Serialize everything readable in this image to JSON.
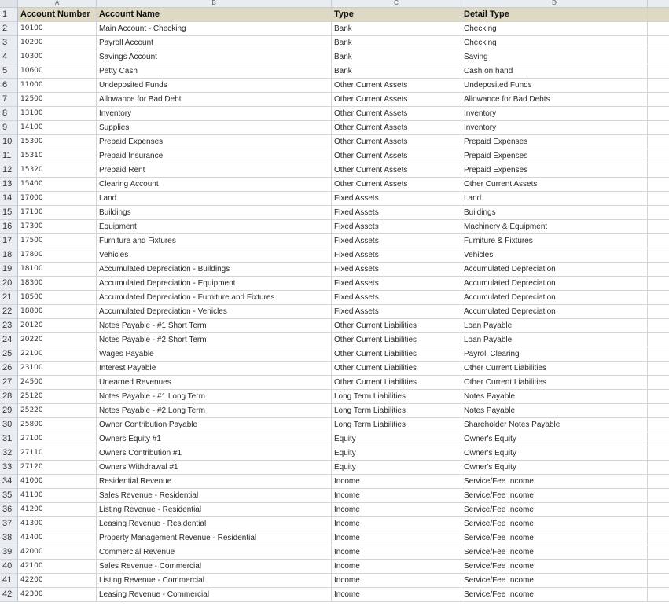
{
  "columns": [
    "A",
    "B",
    "C",
    "D"
  ],
  "header": {
    "row_number": "1",
    "account_number": "Account Number",
    "account_name": "Account Name",
    "type": "Type",
    "detail_type": "Detail Type"
  },
  "rows": [
    {
      "n": "2",
      "num": "10100",
      "name": "Main Account - Checking",
      "type": "Bank",
      "detail": "Checking"
    },
    {
      "n": "3",
      "num": "10200",
      "name": "Payroll Account",
      "type": "Bank",
      "detail": "Checking"
    },
    {
      "n": "4",
      "num": "10300",
      "name": "Savings Account",
      "type": "Bank",
      "detail": "Saving"
    },
    {
      "n": "5",
      "num": "10600",
      "name": "Petty Cash",
      "type": "Bank",
      "detail": "Cash on hand"
    },
    {
      "n": "6",
      "num": "11000",
      "name": "Undeposited Funds",
      "type": "Other Current Assets",
      "detail": "Undeposited Funds"
    },
    {
      "n": "7",
      "num": "12500",
      "name": "Allowance for Bad Debt",
      "type": "Other Current Assets",
      "detail": "Allowance for Bad Debts"
    },
    {
      "n": "8",
      "num": "13100",
      "name": "Inventory",
      "type": "Other Current Assets",
      "detail": "Inventory"
    },
    {
      "n": "9",
      "num": "14100",
      "name": "Supplies",
      "type": "Other Current Assets",
      "detail": "Inventory"
    },
    {
      "n": "10",
      "num": "15300",
      "name": "Prepaid Expenses",
      "type": "Other Current Assets",
      "detail": "Prepaid Expenses"
    },
    {
      "n": "11",
      "num": "15310",
      "name": "Prepaid Insurance",
      "type": "Other Current Assets",
      "detail": "Prepaid Expenses"
    },
    {
      "n": "12",
      "num": "15320",
      "name": "Prepaid Rent",
      "type": "Other Current Assets",
      "detail": "Prepaid Expenses"
    },
    {
      "n": "13",
      "num": "15400",
      "name": "Clearing Account",
      "type": "Other Current Assets",
      "detail": "Other Current Assets"
    },
    {
      "n": "14",
      "num": "17000",
      "name": "Land",
      "type": "Fixed Assets",
      "detail": "Land"
    },
    {
      "n": "15",
      "num": "17100",
      "name": "Buildings",
      "type": "Fixed Assets",
      "detail": "Buildings"
    },
    {
      "n": "16",
      "num": "17300",
      "name": "Equipment",
      "type": "Fixed Assets",
      "detail": "Machinery & Equipment"
    },
    {
      "n": "17",
      "num": "17500",
      "name": "Furniture and Fixtures",
      "type": "Fixed Assets",
      "detail": "Furniture & Fixtures"
    },
    {
      "n": "18",
      "num": "17800",
      "name": "Vehicles",
      "type": "Fixed Assets",
      "detail": "Vehicles"
    },
    {
      "n": "19",
      "num": "18100",
      "name": "Accumulated Depreciation - Buildings",
      "type": "Fixed Assets",
      "detail": "Accumulated Depreciation"
    },
    {
      "n": "20",
      "num": "18300",
      "name": "Accumulated Depreciation - Equipment",
      "type": "Fixed Assets",
      "detail": "Accumulated Depreciation"
    },
    {
      "n": "21",
      "num": "18500",
      "name": "Accumulated Depreciation - Furniture and Fixtures",
      "type": "Fixed Assets",
      "detail": "Accumulated Depreciation"
    },
    {
      "n": "22",
      "num": "18800",
      "name": "Accumulated Depreciation - Vehicles",
      "type": "Fixed Assets",
      "detail": "Accumulated Depreciation"
    },
    {
      "n": "23",
      "num": "20120",
      "name": "Notes Payable - #1 Short Term",
      "type": "Other Current Liabilities",
      "detail": "Loan Payable"
    },
    {
      "n": "24",
      "num": "20220",
      "name": "Notes Payable - #2 Short Term",
      "type": "Other Current Liabilities",
      "detail": "Loan Payable"
    },
    {
      "n": "25",
      "num": "22100",
      "name": "Wages Payable",
      "type": "Other Current Liabilities",
      "detail": "Payroll Clearing"
    },
    {
      "n": "26",
      "num": "23100",
      "name": "Interest Payable",
      "type": "Other Current Liabilities",
      "detail": "Other Current Liabilities"
    },
    {
      "n": "27",
      "num": "24500",
      "name": "Unearned Revenues",
      "type": "Other Current Liabilities",
      "detail": "Other Current Liabilities"
    },
    {
      "n": "28",
      "num": "25120",
      "name": "Notes Payable - #1 Long Term",
      "type": "Long Term Liabilities",
      "detail": "Notes Payable"
    },
    {
      "n": "29",
      "num": "25220",
      "name": "Notes Payable - #2 Long Term",
      "type": "Long Term Liabilities",
      "detail": "Notes Payable"
    },
    {
      "n": "30",
      "num": "25800",
      "name": "Owner Contribution Payable",
      "type": "Long Term Liabilities",
      "detail": "Shareholder Notes Payable"
    },
    {
      "n": "31",
      "num": "27100",
      "name": "Owners Equity #1",
      "type": "Equity",
      "detail": "Owner's Equity"
    },
    {
      "n": "32",
      "num": "27110",
      "name": "Owners Contribution #1",
      "type": "Equity",
      "detail": "Owner's Equity"
    },
    {
      "n": "33",
      "num": "27120",
      "name": "Owners Withdrawal #1",
      "type": "Equity",
      "detail": "Owner's Equity"
    },
    {
      "n": "34",
      "num": "41000",
      "name": "Residential Revenue",
      "type": "Income",
      "detail": "Service/Fee Income"
    },
    {
      "n": "35",
      "num": "41100",
      "name": "Sales Revenue - Residential",
      "type": "Income",
      "detail": "Service/Fee Income"
    },
    {
      "n": "36",
      "num": "41200",
      "name": "Listing Revenue - Residential",
      "type": "Income",
      "detail": "Service/Fee Income"
    },
    {
      "n": "37",
      "num": "41300",
      "name": "Leasing Revenue - Residential",
      "type": "Income",
      "detail": "Service/Fee Income"
    },
    {
      "n": "38",
      "num": "41400",
      "name": "Property Management Revenue - Residential",
      "type": "Income",
      "detail": "Service/Fee Income"
    },
    {
      "n": "39",
      "num": "42000",
      "name": "Commercial Revenue",
      "type": "Income",
      "detail": "Service/Fee Income"
    },
    {
      "n": "40",
      "num": "42100",
      "name": "Sales Revenue - Commercial",
      "type": "Income",
      "detail": "Service/Fee Income"
    },
    {
      "n": "41",
      "num": "42200",
      "name": "Listing Revenue - Commercial",
      "type": "Income",
      "detail": "Service/Fee Income"
    },
    {
      "n": "42",
      "num": "42300",
      "name": "Leasing Revenue - Commercial",
      "type": "Income",
      "detail": "Service/Fee Income"
    }
  ]
}
